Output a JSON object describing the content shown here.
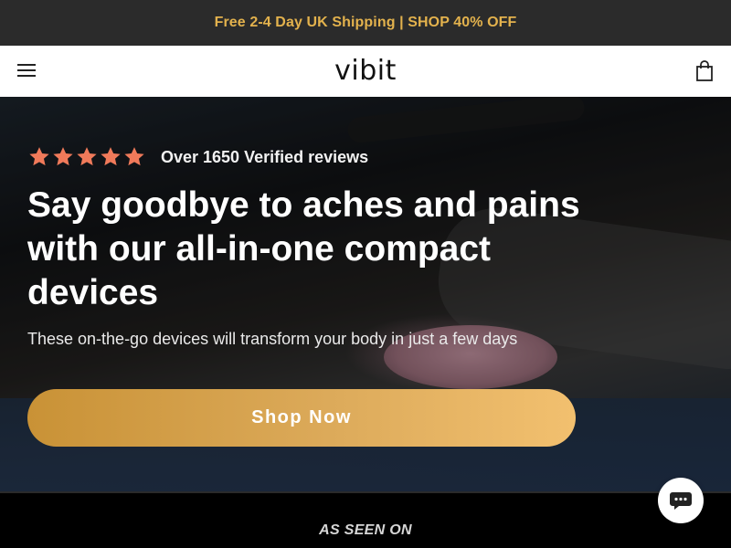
{
  "announcement": {
    "text": "Free 2-4 Day UK Shipping | SHOP 40% OFF"
  },
  "header": {
    "logo": "vibit",
    "menu_icon": "hamburger-menu-icon",
    "cart_icon": "shopping-bag-icon"
  },
  "hero": {
    "rating": {
      "stars": 5,
      "text": "Over 1650 Verified reviews"
    },
    "headline": "Say goodbye to aches and pains with our all-in-one compact devices",
    "subheadline": "These on-the-go devices will transform your body in just a few days",
    "cta_label": "Shop Now"
  },
  "as_seen_on": {
    "label": "AS SEEN ON"
  },
  "chat": {
    "icon": "chat-bubble-icon"
  },
  "colors": {
    "announcement_bg": "#2b2b2b",
    "announcement_text": "#e3b24d",
    "star": "#f07a5a",
    "cta_start": "#c99236",
    "cta_end": "#f2c06f"
  }
}
